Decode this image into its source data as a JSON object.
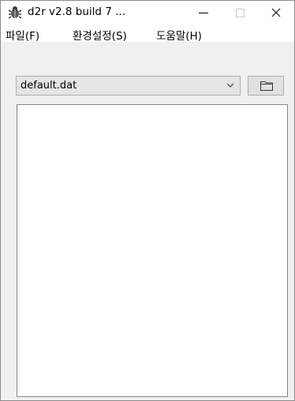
{
  "window": {
    "title": "d2r v2.8 build 7 ...",
    "app_icon": "beetle-icon",
    "caption_buttons": [
      "minimize-icon",
      "maximize-icon",
      "close-icon"
    ]
  },
  "menu": {
    "items": [
      {
        "label": "파일(F)"
      },
      {
        "label": "환경설정(S)"
      },
      {
        "label": "도움말(H)"
      }
    ]
  },
  "toolbar": {
    "selected_file": "default.dat",
    "dropdown_icon": "chevron-down-icon",
    "folder_icon": "folder-icon"
  },
  "colors": {
    "window_bg": "#f0f0f0",
    "titlebar_bg": "#ffffff",
    "combo_bg": "#e5e5e5",
    "border": "#adadad"
  }
}
